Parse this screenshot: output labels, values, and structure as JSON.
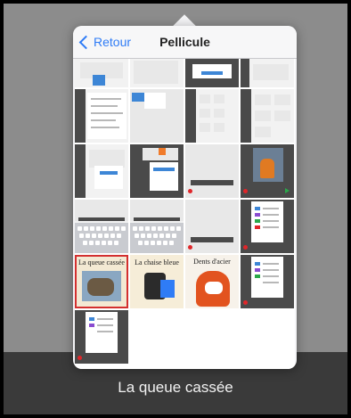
{
  "popover": {
    "back_label": "Retour",
    "title": "Pellicule"
  },
  "books": {
    "book1_title": "La queue cassée",
    "book2_title": "La chaise bleue",
    "book3_title": "Dents d'acier"
  },
  "caption": "La queue cassée",
  "colors": {
    "accent": "#2f7cf6",
    "selection": "#d32f2f",
    "record_dot": "#e0262a",
    "play": "#2aa84a"
  },
  "icons": [
    "chevron-left-icon",
    "record-icon",
    "play-icon"
  ]
}
